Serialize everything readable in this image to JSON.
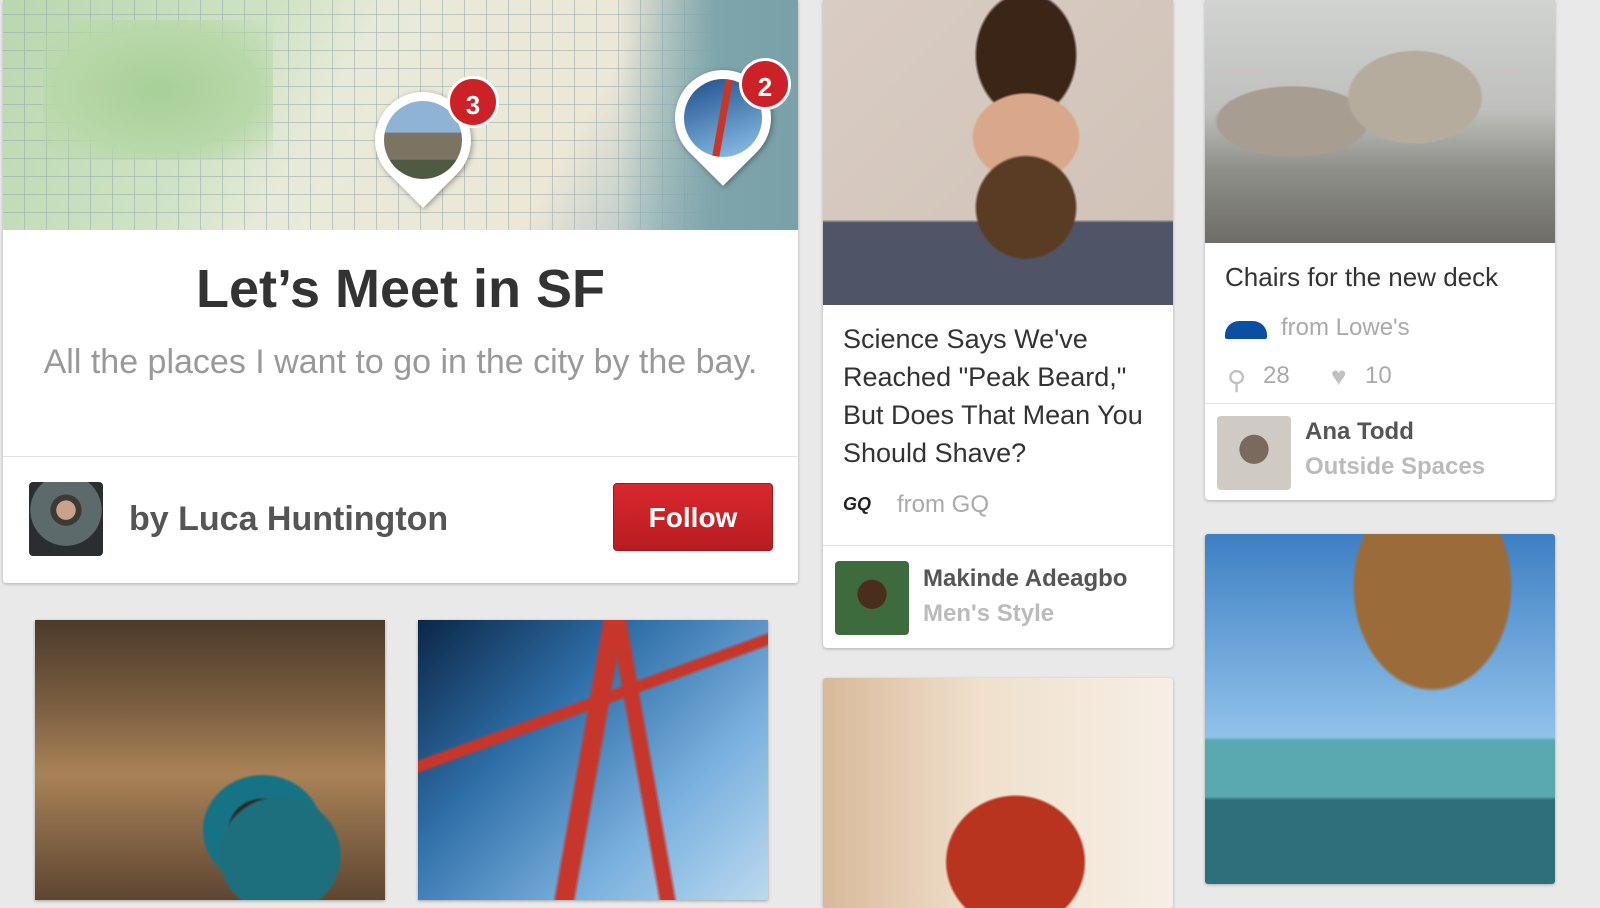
{
  "board": {
    "title": "Let’s Meet in SF",
    "description": "All the places I want to go in the city by the bay.",
    "byline": "by Luca Huntington",
    "follow_label": "Follow",
    "map_pins": [
      {
        "name": "houses",
        "count": "3"
      },
      {
        "name": "golden-gate",
        "count": "2"
      }
    ]
  },
  "pins": {
    "beard": {
      "title": "Science Says We've Reached \"Peak Beard,\" But Does That Mean You Should Shave?",
      "source_logo": "GQ",
      "source": "from GQ",
      "pinner": "Makinde Adeagbo",
      "pinner_board": "Men's Style"
    },
    "chairs": {
      "title": "Chairs for the new deck",
      "source": "from Lowe's",
      "repins": "28",
      "likes": "10",
      "pinner": "Ana Todd",
      "pinner_board": "Outside Spaces"
    }
  },
  "icons": {
    "repin": "pushpin-icon",
    "like": "heart-icon"
  },
  "colors": {
    "accent_red": "#cc2127",
    "background": "#e9e9e9"
  }
}
